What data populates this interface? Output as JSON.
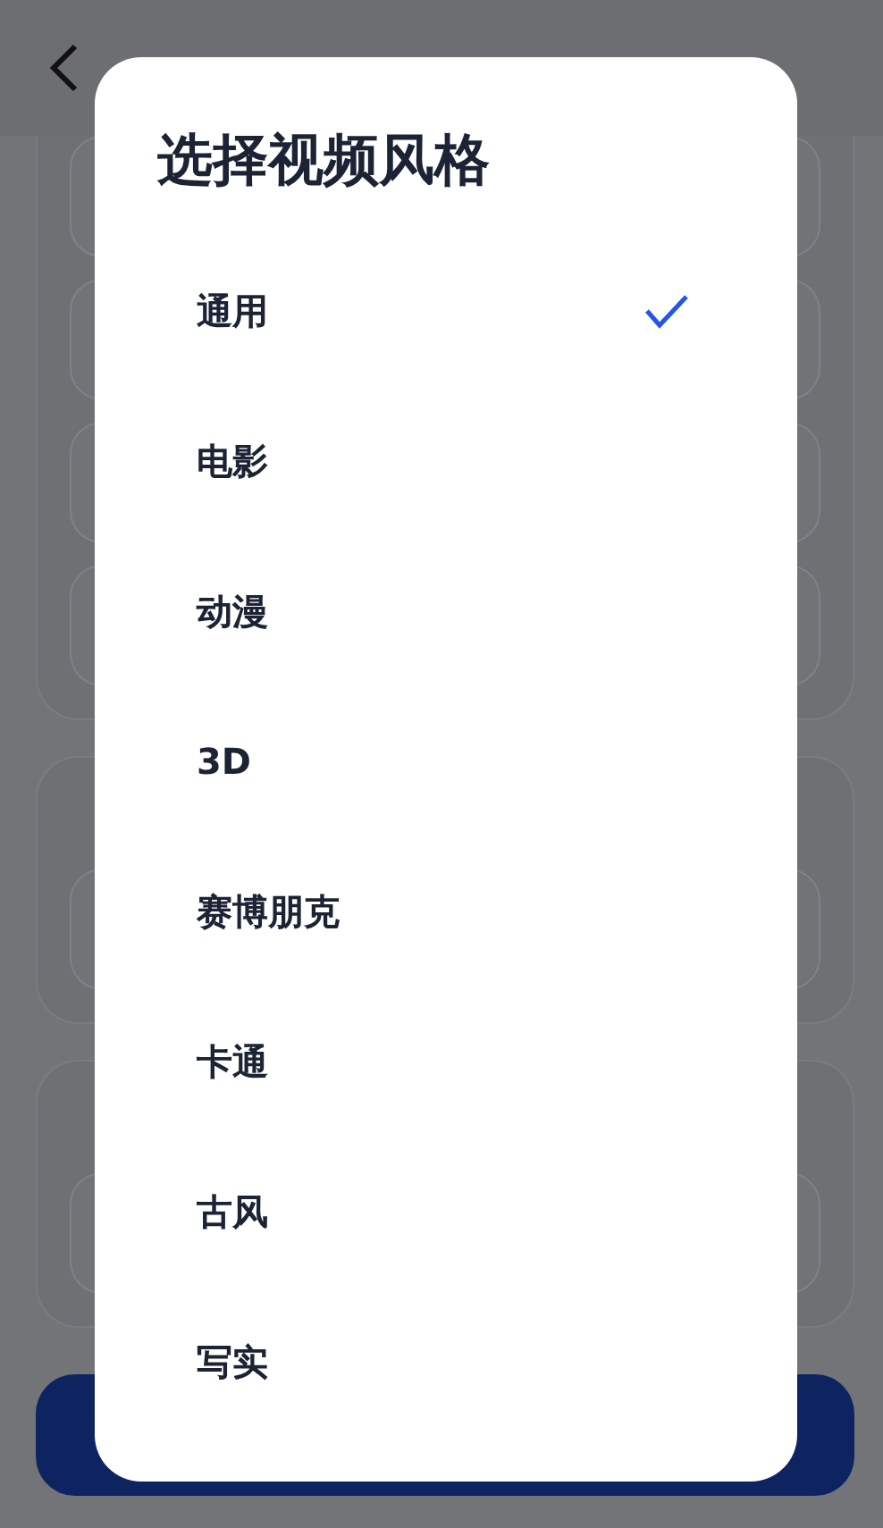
{
  "dialog": {
    "title": "选择视频风格",
    "options": [
      {
        "label": "通用",
        "selected": true
      },
      {
        "label": "电影",
        "selected": false
      },
      {
        "label": "动漫",
        "selected": false
      },
      {
        "label": "3D",
        "selected": false
      },
      {
        "label": "赛博朋克",
        "selected": false
      },
      {
        "label": "卡通",
        "selected": false
      },
      {
        "label": "古风",
        "selected": false
      },
      {
        "label": "写实",
        "selected": false
      }
    ]
  }
}
